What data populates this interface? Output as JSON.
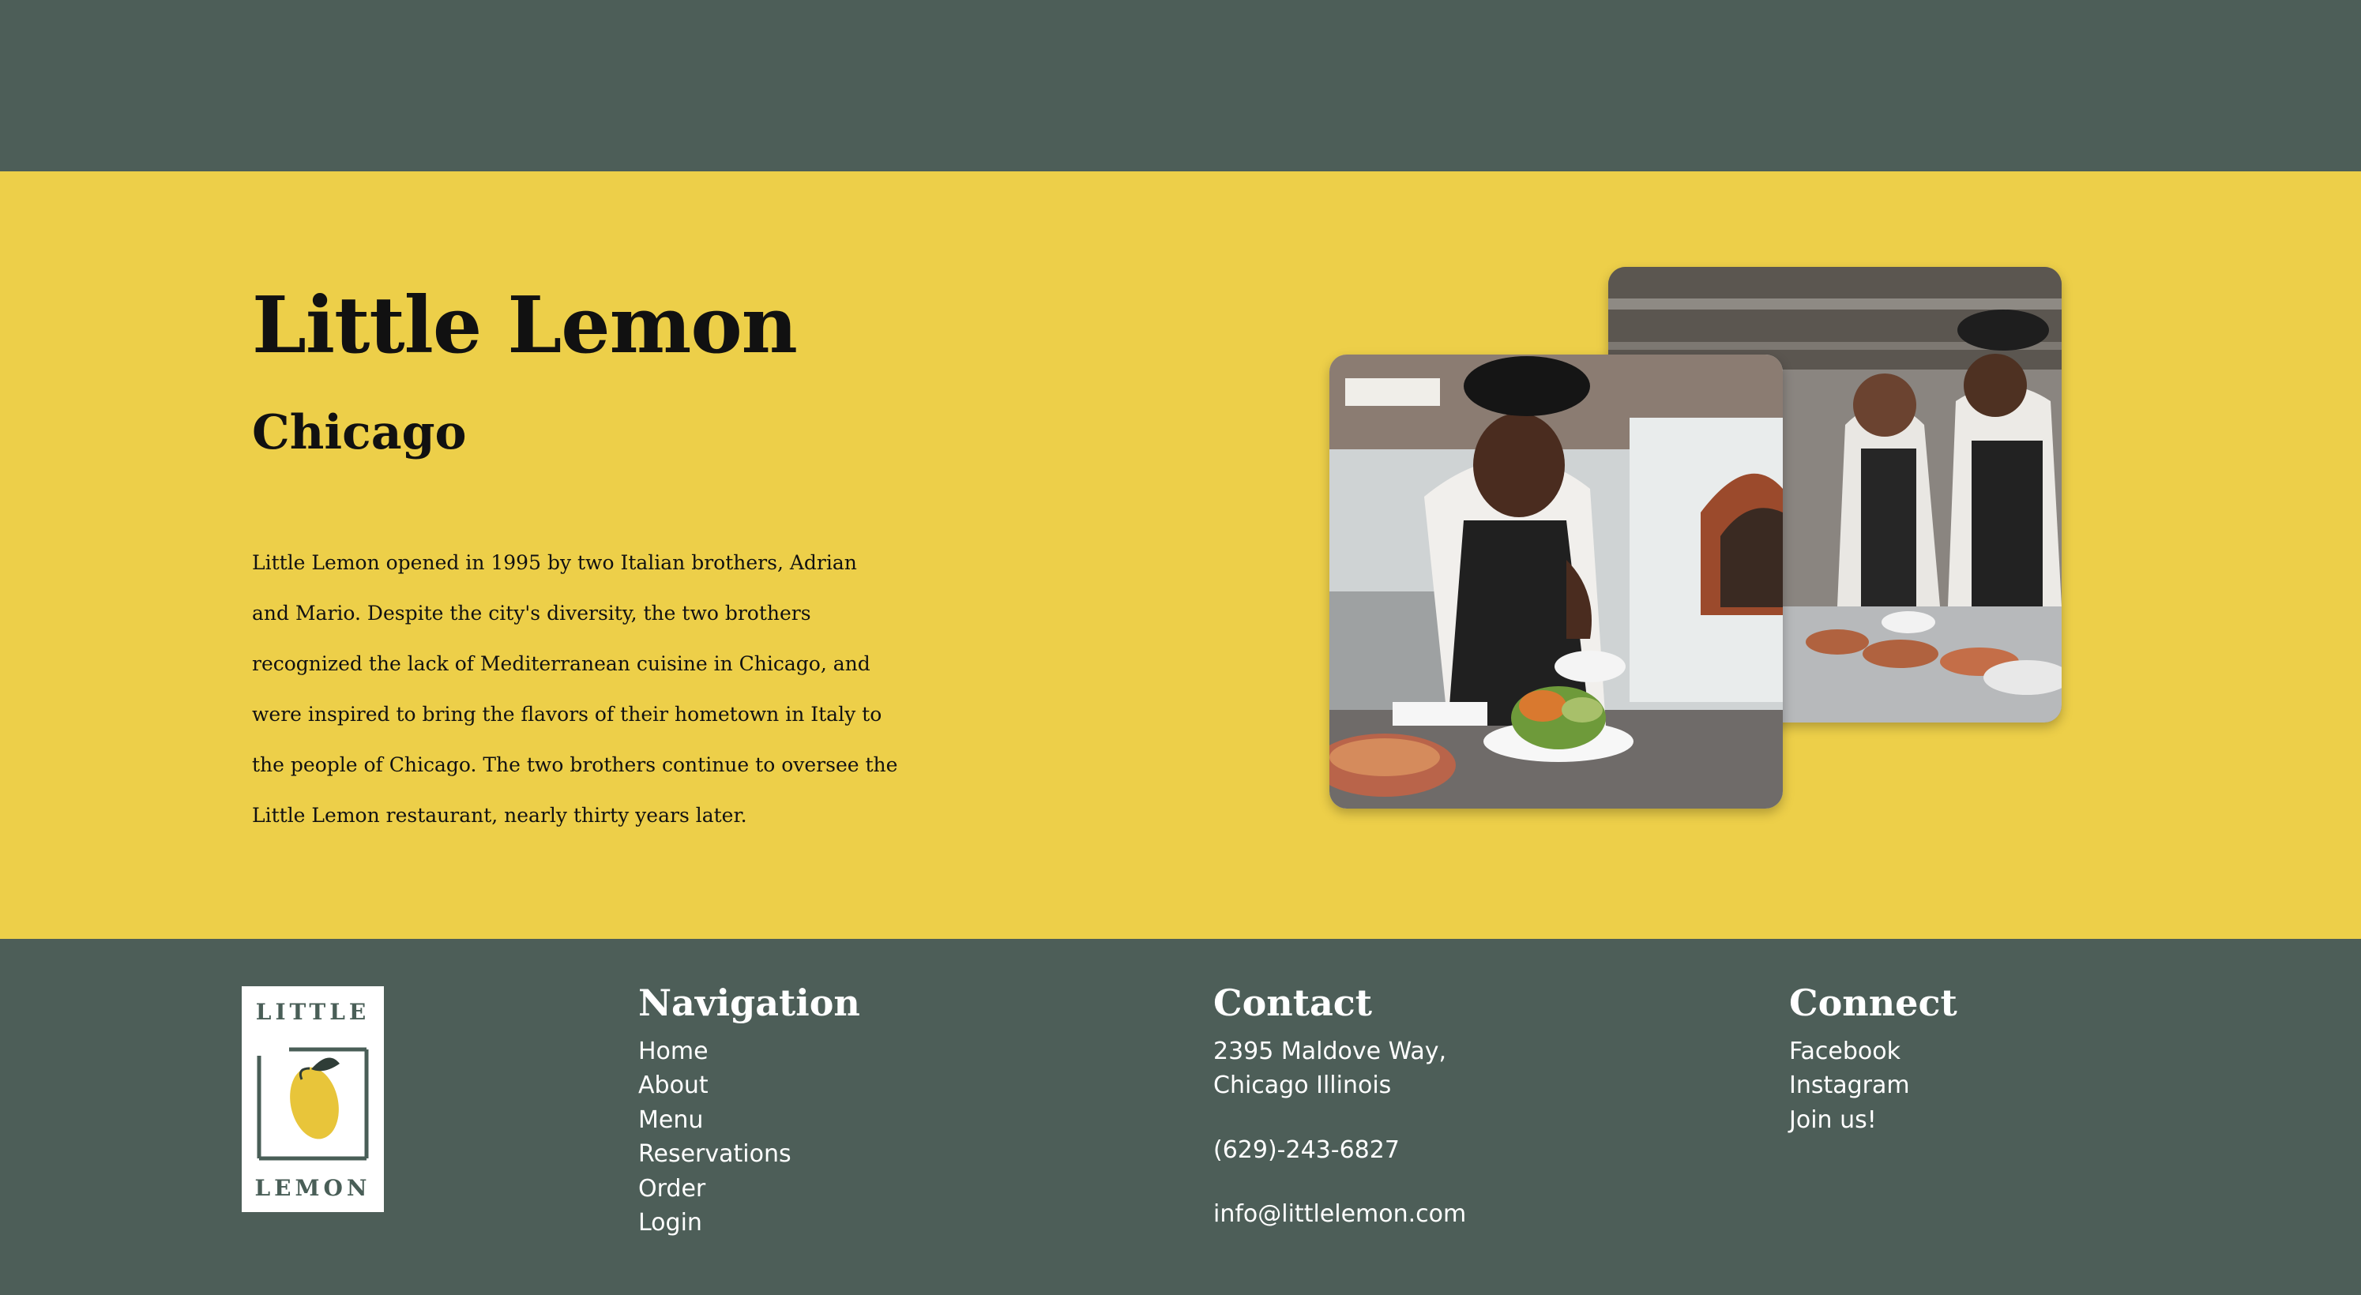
{
  "hero": {
    "title": "Little Lemon",
    "subtitle": "Chicago",
    "description": "Little Lemon opened in 1995 by two Italian brothers, Adrian and Mario. Despite the city's diversity, the two brothers recognized the lack of Mediterranean cuisine in Chicago, and were inspired to bring the flavors of their hometown in Italy to the people of Chicago. The two brothers continue to oversee the Little Lemon restaurant, nearly thirty years later.",
    "images": [
      {
        "name": "two-chefs-talking-photo"
      },
      {
        "name": "chef-plating-salad-photo"
      }
    ]
  },
  "footer": {
    "logo": {
      "line1": "LITTLE",
      "line2": "LEMON"
    },
    "navigation": {
      "heading": "Navigation",
      "links": [
        "Home",
        "About",
        "Menu",
        "Reservations",
        "Order",
        "Login"
      ]
    },
    "contact": {
      "heading": "Contact",
      "address_line1": "2395 Maldove Way,",
      "address_line2": "Chicago Illinois",
      "phone": "(629)-243-6827",
      "email": "info@littlelemon.com"
    },
    "connect": {
      "heading": "Connect",
      "links": [
        "Facebook",
        "Instagram",
        "Join us!"
      ]
    }
  },
  "colors": {
    "primary_green": "#495e57",
    "primary_yellow": "#f4ce14",
    "text_dark": "#111111",
    "text_light": "#ffffff"
  }
}
